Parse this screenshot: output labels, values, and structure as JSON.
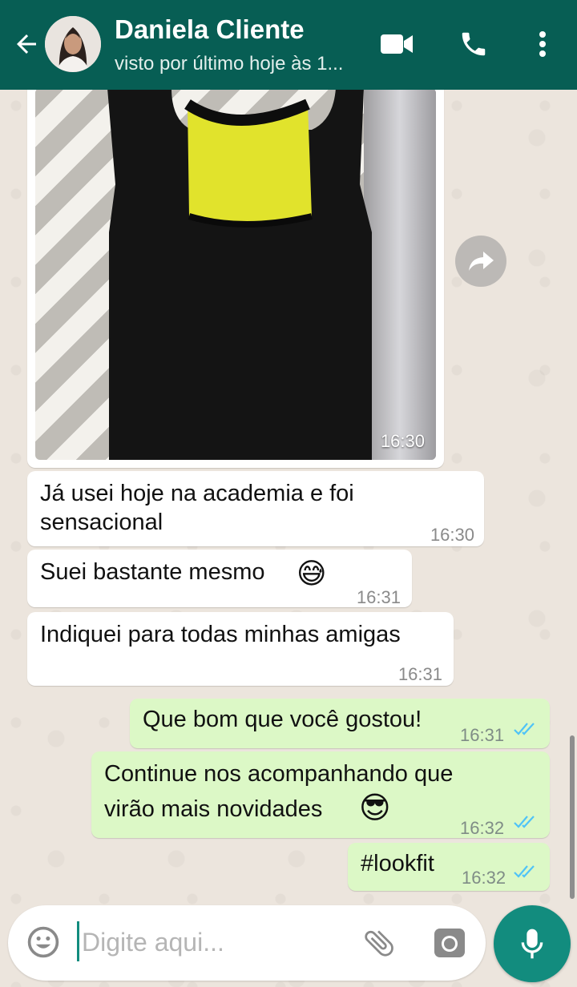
{
  "header": {
    "contact_name": "Daniela Cliente",
    "status": "visto por último hoje às 1...",
    "icons": [
      "back-arrow-icon",
      "video-call-icon",
      "phone-icon",
      "more-vert-icon"
    ],
    "bg_color": "#075e54"
  },
  "image_message": {
    "time": "16:30",
    "description_icon": "forward-icon"
  },
  "messages": [
    {
      "direction": "in",
      "lines": [
        "Já usei hoje na academia e foi",
        "sensacional"
      ],
      "time": "16:30"
    },
    {
      "direction": "in",
      "text": "Suei bastante mesmo",
      "emoji": "😅",
      "time": "16:31"
    },
    {
      "direction": "in",
      "text": "Indiquei para todas minhas amigas",
      "time": "16:31"
    },
    {
      "direction": "out",
      "text": "Que bom que você gostou!",
      "time": "16:31",
      "status": "read"
    },
    {
      "direction": "out",
      "lines": [
        "Continue nos acompanhando que",
        "virão  mais novidades"
      ],
      "emoji": "😎",
      "time": "16:32",
      "status": "read"
    },
    {
      "direction": "out",
      "text": "#lookfit",
      "time": "16:32",
      "status": "read"
    }
  ],
  "composer": {
    "placeholder": "Digite aqui...",
    "value": "",
    "icons": [
      "emoji-icon",
      "attach-icon",
      "camera-icon",
      "mic-icon"
    ],
    "accent": "#128c7e"
  },
  "colors": {
    "incoming": "#ffffff",
    "outgoing": "#dcf8c6",
    "read_ticks": "#4fc3f7"
  }
}
